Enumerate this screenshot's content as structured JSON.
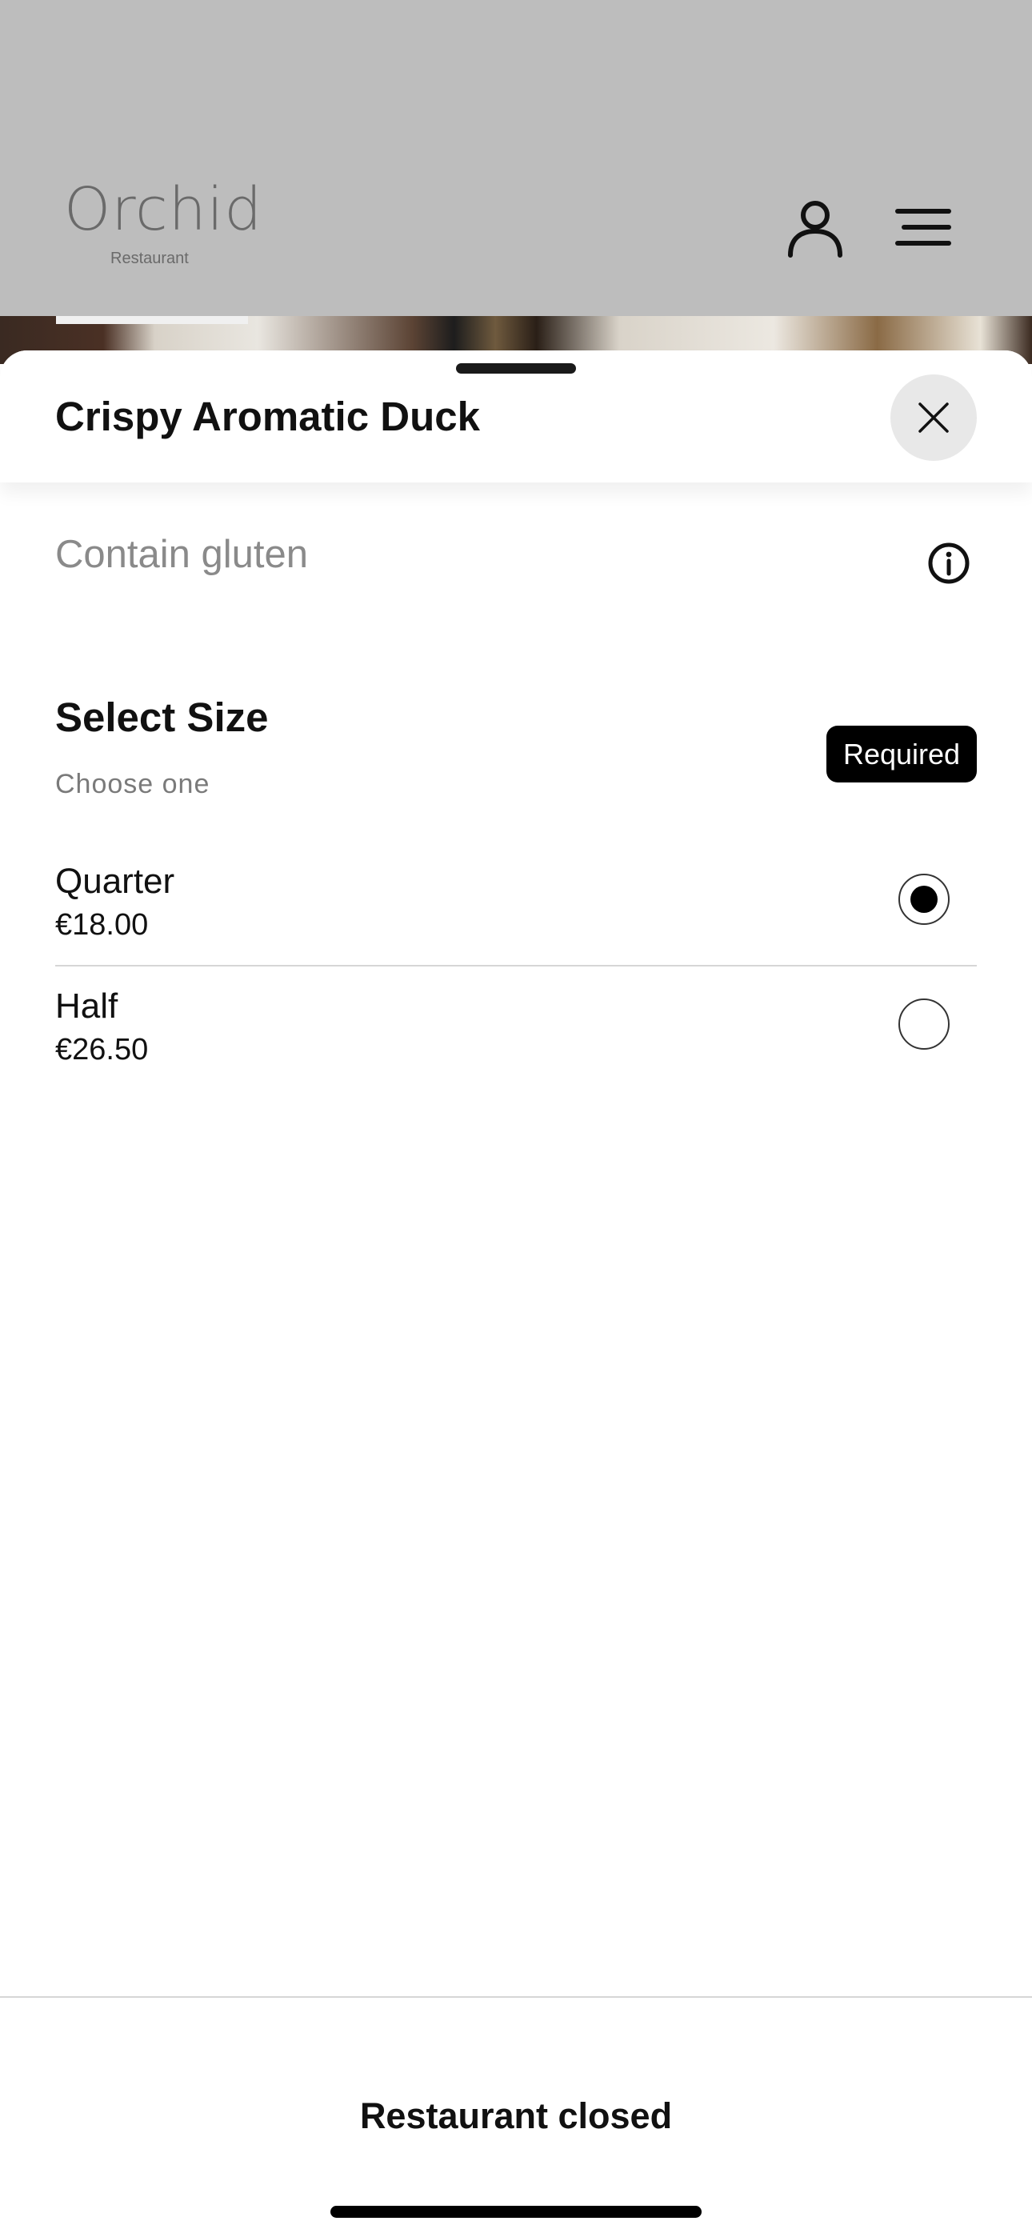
{
  "header": {
    "logo_main": "Orchid",
    "logo_sub": "Restaurant",
    "account_icon": "user-icon",
    "menu_icon": "hamburger-menu-icon"
  },
  "sheet": {
    "title": "Crispy Aromatic Duck",
    "close_icon": "close-icon",
    "allergen_text": "Contain gluten",
    "info_icon": "info-icon"
  },
  "size_group": {
    "title": "Select Size",
    "subtitle": "Choose one",
    "badge": "Required",
    "options": [
      {
        "name": "Quarter",
        "price": "€18.00",
        "selected": true
      },
      {
        "name": "Half",
        "price": "€26.50",
        "selected": false
      }
    ]
  },
  "footer": {
    "status_label": "Restaurant closed"
  },
  "colors": {
    "header_bg": "#bdbdbd",
    "badge_bg": "#000000",
    "close_button_bg": "#e8e8e8",
    "muted_text": "#8a8a8a"
  }
}
